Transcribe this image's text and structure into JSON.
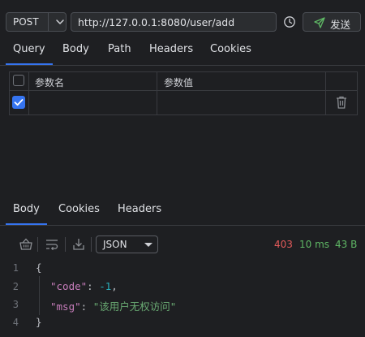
{
  "request": {
    "method": "POST",
    "url": "http://127.0.0.1:8080/user/add",
    "send_label": "发送"
  },
  "request_tabs": [
    {
      "label": "Query",
      "active": true
    },
    {
      "label": "Body",
      "active": false
    },
    {
      "label": "Path",
      "active": false
    },
    {
      "label": "Headers",
      "active": false
    },
    {
      "label": "Cookies",
      "active": false
    }
  ],
  "params_table": {
    "col_name": "参数名",
    "col_value": "参数值",
    "row_checked": true,
    "row_name": "",
    "row_value": ""
  },
  "response_tabs": [
    {
      "label": "Body",
      "active": true
    },
    {
      "label": "Cookies",
      "active": false
    },
    {
      "label": "Headers",
      "active": false
    }
  ],
  "response_toolbar": {
    "format": "JSON",
    "status_code": "403",
    "time": "10 ms",
    "size": "43 B"
  },
  "response_body": {
    "line_numbers": [
      "1",
      "2",
      "3",
      "4"
    ],
    "open_brace": "{",
    "close_brace": "}",
    "lines": [
      {
        "key": "\"code\"",
        "value": "-1",
        "value_type": "number",
        "trail": ","
      },
      {
        "key": "\"msg\"",
        "value": "\"该用户无权访问\"",
        "value_type": "string",
        "trail": ""
      }
    ]
  },
  "colors": {
    "background": "#1e1f22",
    "accent": "#3574f0",
    "status_error": "#e55b5b",
    "status_ok": "#5fb865"
  }
}
